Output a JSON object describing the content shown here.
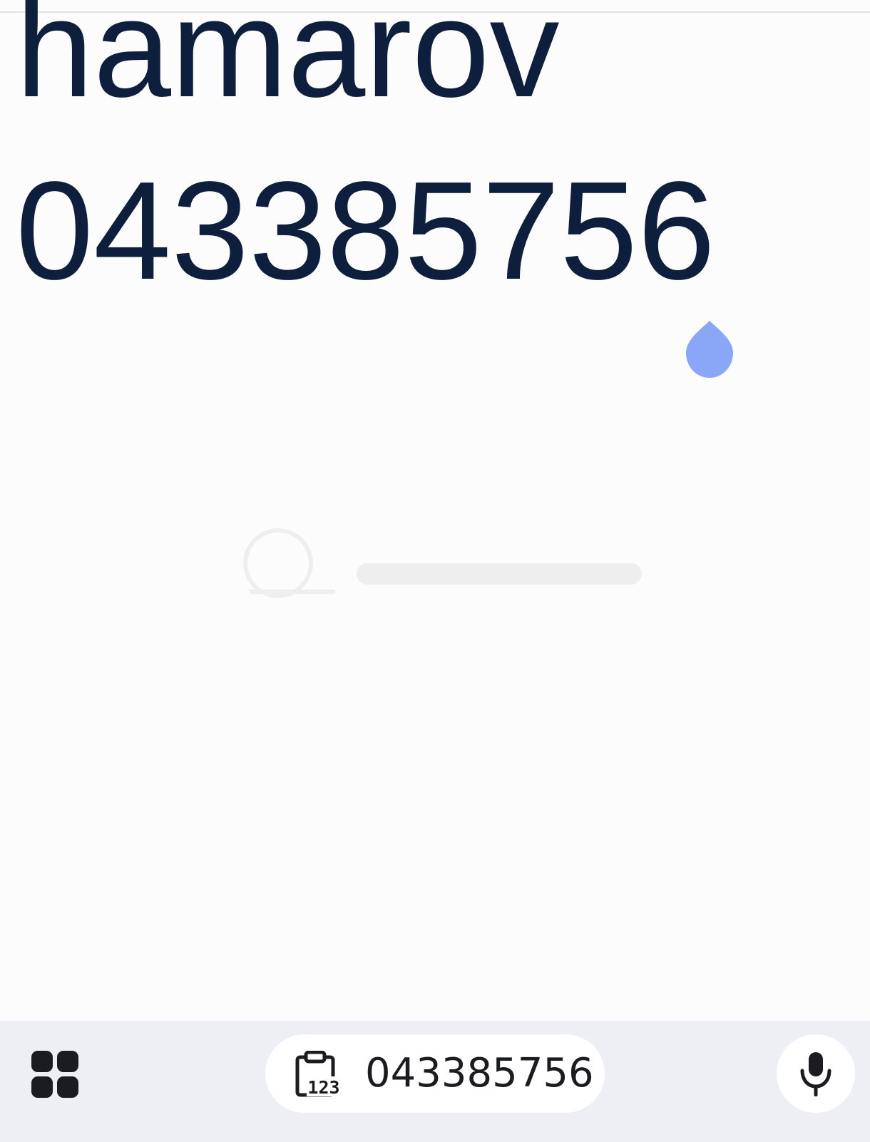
{
  "note": {
    "lines": [
      "hamarov",
      "043385756"
    ]
  },
  "keyboard": {
    "suggestion_text": "043385756",
    "clipboard_icon_text": "123",
    "icons": {
      "apps": "apps-grid-icon",
      "clipboard": "clipboard-123-icon",
      "mic": "microphone-icon",
      "cursor": "text-cursor-handle"
    }
  },
  "colors": {
    "text": "#0d1f3c",
    "cursor_handle": "#8aa6f7",
    "background": "#fcfcfd",
    "keyboard_bar": "#eeeff4",
    "icon_dark": "#1b1c20"
  }
}
